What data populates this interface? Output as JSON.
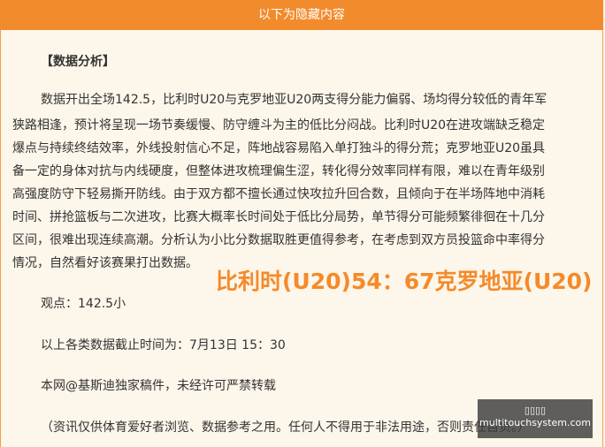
{
  "header": {
    "title": "以下为隐藏内容"
  },
  "article": {
    "section_title": "【数据分析】",
    "paragraph_lines": [
      "数据开出全场142.5，比利时U20与克罗地亚U20两支得分能力偏弱、场均得分较低的青年军",
      "狭路相逢，预计将呈现一场节奏缓慢、防守缠斗为主的低比分闷战。比利时U20在进攻端缺乏稳定",
      "爆点与持续终结效率，外线投射信心不足，阵地战容易陷入单打独斗的得分荒；克罗地亚U20虽具",
      "备一定的身体对抗与内线硬度，但整体进攻梳理偏生涩，转化得分效率同样有限，难以在青年级别",
      "高强度防守下轻易撕开防线。由于双方都不擅长通过快攻拉升回合数，且倾向于在半场阵地中消耗",
      "时间、拼抢篮板与二次进攻，比赛大概率长时间处于低比分局势，单节得分可能频繁徘徊在十几分",
      "区间，很难出现连续高潮。分析认为小比分数据取胜更值得参考，在考虑到双方员投篮命中率得分",
      "情况，自然看好该赛果打出数据。"
    ],
    "viewpoint": "观点：142.5小",
    "cutoff": "以上各类数据截止时间为：7月13日 15：30",
    "copyright": "本网@基斯迪独家稿件，未经许可严禁转载",
    "disclaimer": "（资讯仅供体育爱好者浏览、数据参考之用。任何人不得用于非法用途，否则责任自负。）"
  },
  "score_overlay": "比利时(U20)54：67克罗地亚(U20)",
  "watermark": {
    "icon": "▯▯▯▯",
    "text": "multitouchsystem.com"
  },
  "colors": {
    "header": "#f28b2c",
    "score": "#f58a2a",
    "background": "#fdf6ea",
    "border": "#f0a048"
  }
}
